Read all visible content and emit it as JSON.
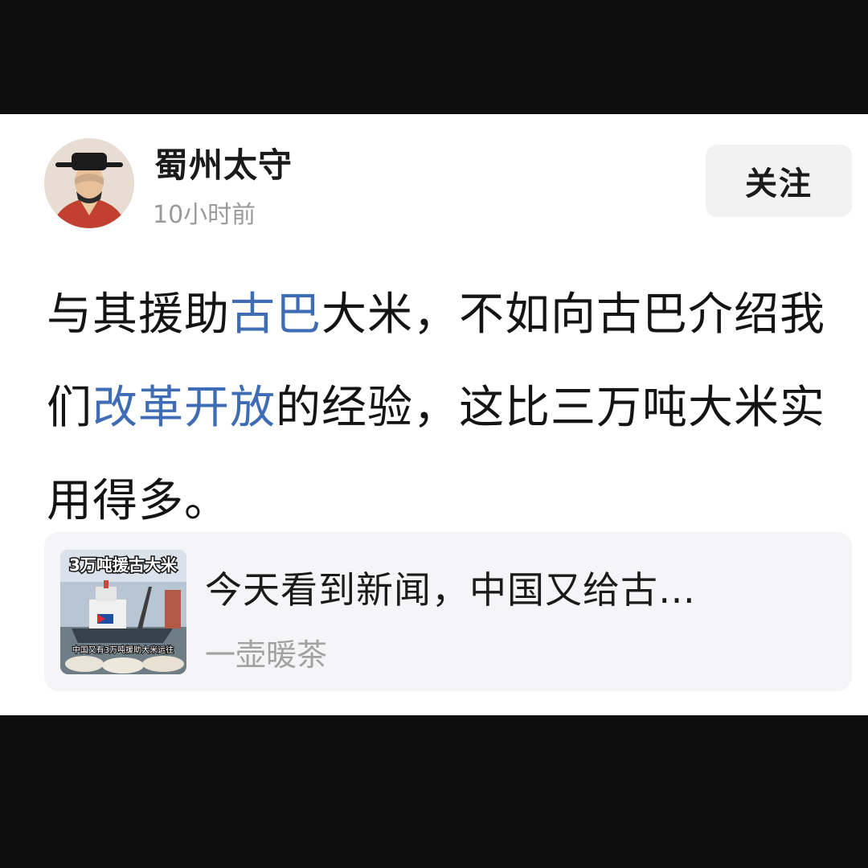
{
  "post": {
    "author": "蜀州太守",
    "time": "10小时前",
    "follow_label": "关注",
    "segments": [
      {
        "text": "与其援助",
        "link": false
      },
      {
        "text": "古巴",
        "link": true
      },
      {
        "text": "大米，不如向古巴介绍我们",
        "link": false
      },
      {
        "text": "改革开放",
        "link": true
      },
      {
        "text": "的经验，这比三万吨大米实用得多。",
        "link": false
      }
    ]
  },
  "quote": {
    "title": "今天看到新闻，中国又给古…",
    "source": "一壶暖茶",
    "thumb_caption_top": "3万吨援古大米",
    "thumb_caption_bottom": "中国又有3万吨援助大米运往"
  },
  "colors": {
    "link": "#3e6db5",
    "page_background": "#0e0e0e",
    "card": "#ffffff",
    "quote_background": "#f5f5f7"
  }
}
